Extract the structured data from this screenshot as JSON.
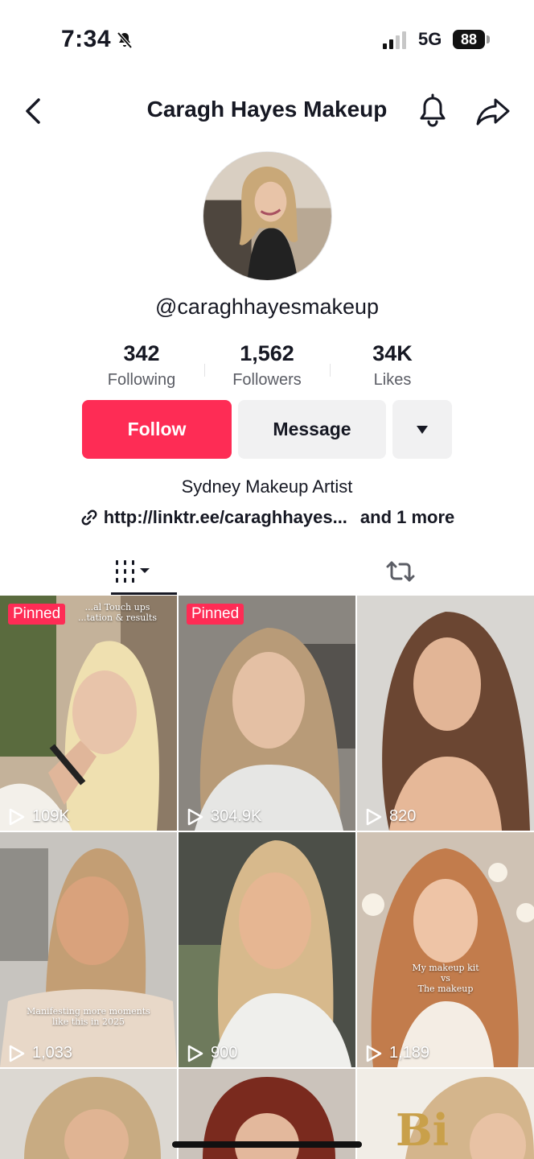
{
  "status_bar": {
    "time": "7:34",
    "network": "5G",
    "battery": "88"
  },
  "header": {
    "title": "Caragh Hayes Makeup"
  },
  "profile": {
    "username": "@caraghhayesmakeup",
    "stats": [
      {
        "value": "342",
        "label": "Following"
      },
      {
        "value": "1,562",
        "label": "Followers"
      },
      {
        "value": "34K",
        "label": "Likes"
      }
    ],
    "follow_label": "Follow",
    "message_label": "Message",
    "bio": "Sydney Makeup Artist",
    "link": "http://linktr.ee/caraghhayes...",
    "link_more": "and 1 more"
  },
  "colors": {
    "accent": "#fe2c55",
    "secondary_button": "#f1f1f2"
  },
  "videos": [
    {
      "views": "109K",
      "pinned": "Pinned",
      "overlay": [
        "...al Touch ups",
        "...tation & results"
      ]
    },
    {
      "views": "304.9K",
      "pinned": "Pinned"
    },
    {
      "views": "820"
    },
    {
      "views": "1,033",
      "overlay": [
        "Manifesting more moments",
        "like this in 2025"
      ]
    },
    {
      "views": "900"
    },
    {
      "views": "1,189",
      "overlay": [
        "My makeup kit",
        "vs",
        "The makeup"
      ]
    },
    {
      "views": ""
    },
    {
      "views": ""
    },
    {
      "views": ""
    }
  ]
}
